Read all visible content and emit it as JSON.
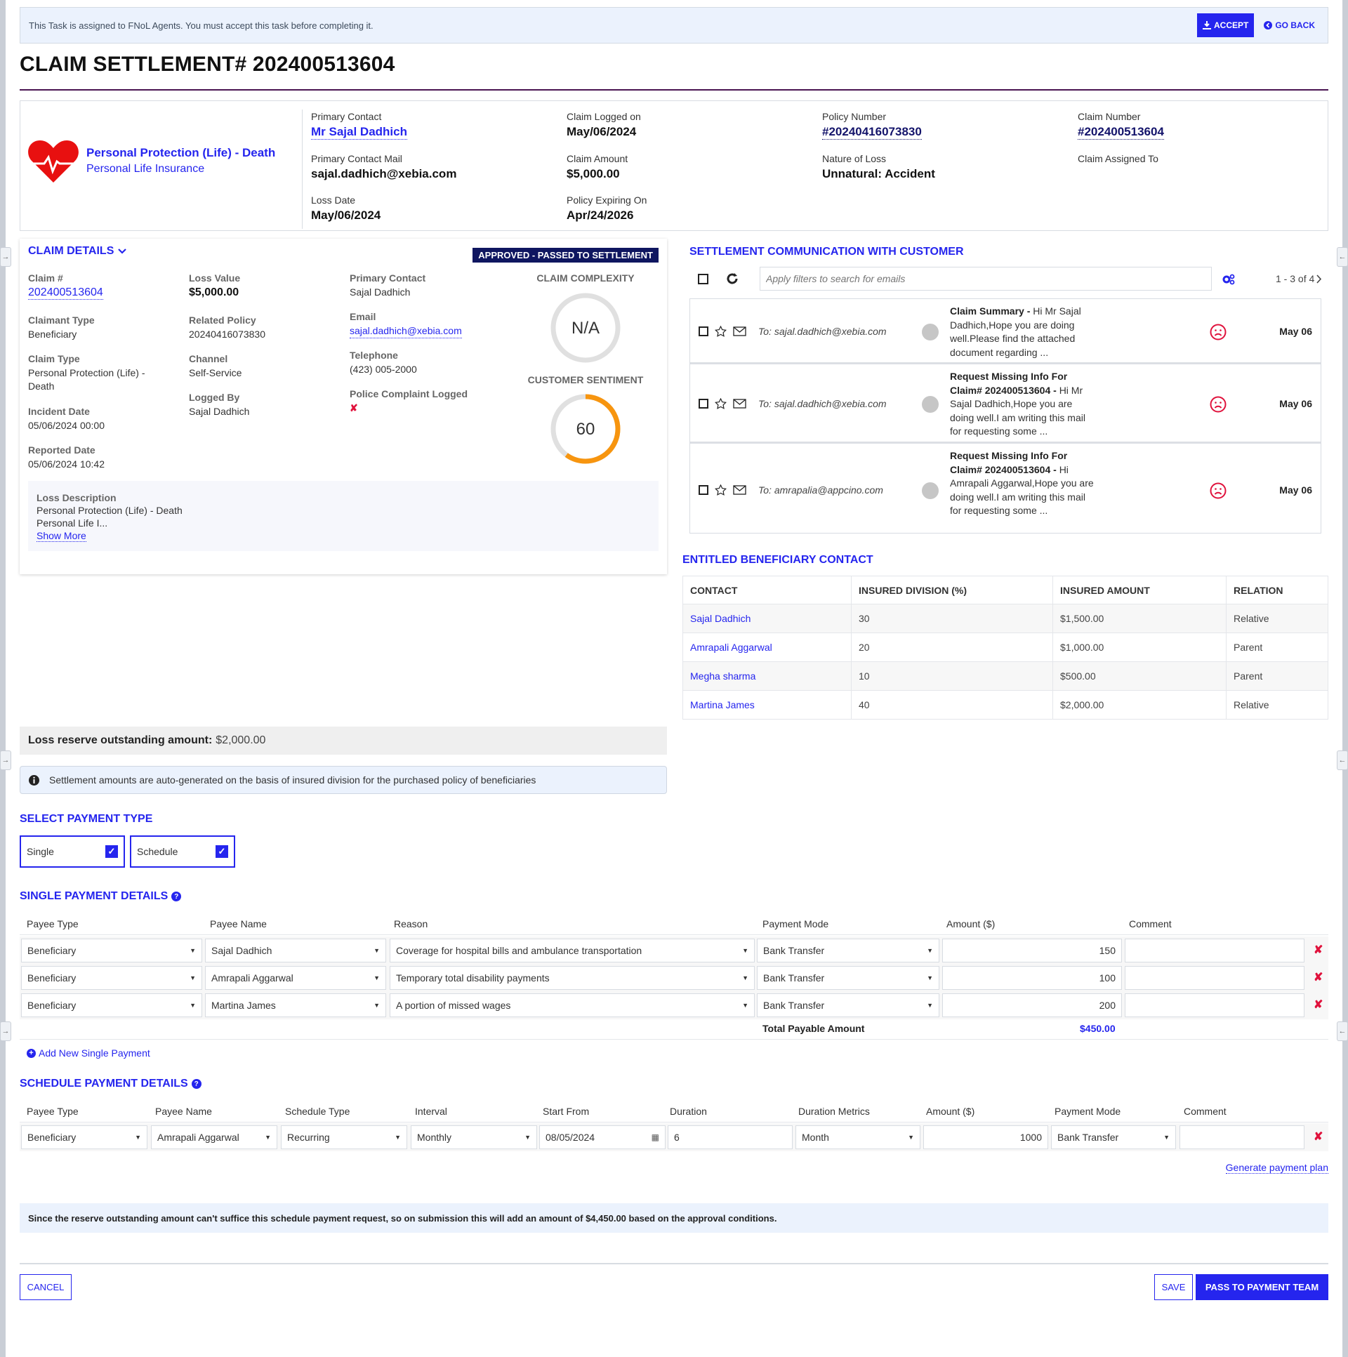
{
  "banner": {
    "message": "This Task is assigned to FNoL Agents. You must accept this task before completing it.",
    "accept_label": "ACCEPT",
    "go_back_label": "GO BACK"
  },
  "page_title": "CLAIM SETTLEMENT# 202400513604",
  "summary": {
    "product_name": "Personal Protection (Life) - Death",
    "product_sub": "Personal Life Insurance",
    "fields": {
      "primary_contact": {
        "label": "Primary Contact",
        "value": "Mr Sajal  Dadhich"
      },
      "primary_contact_mail": {
        "label": "Primary Contact Mail",
        "value": "sajal.dadhich@xebia.com"
      },
      "loss_date": {
        "label": "Loss Date",
        "value": "May/06/2024"
      },
      "claim_logged_on": {
        "label": "Claim Logged on",
        "value": "May/06/2024"
      },
      "claim_amount": {
        "label": "Claim Amount",
        "value": "$5,000.00"
      },
      "policy_expiring_on": {
        "label": "Policy Expiring On",
        "value": "Apr/24/2026"
      },
      "policy_number": {
        "label": "Policy Number",
        "value": "#20240416073830"
      },
      "nature_of_loss": {
        "label": "Nature of Loss",
        "value": "Unnatural: Accident"
      },
      "claim_number": {
        "label": "Claim Number",
        "value": "#202400513604"
      },
      "claim_assigned_to": {
        "label": "Claim Assigned To",
        "value": ""
      }
    }
  },
  "claim_details": {
    "title": "CLAIM DETAILS",
    "status": "APPROVED - PASSED TO SETTLEMENT",
    "claim_no": {
      "label": "Claim #",
      "value": "202400513604"
    },
    "claimant_type": {
      "label": "Claimant Type",
      "value": "Beneficiary"
    },
    "claim_type": {
      "label": "Claim Type",
      "value": "Personal Protection (Life) - Death"
    },
    "incident_date": {
      "label": "Incident Date",
      "value": "05/06/2024 00:00"
    },
    "reported_date": {
      "label": "Reported Date",
      "value": "05/06/2024 10:42"
    },
    "loss_value": {
      "label": "Loss Value",
      "value": "$5,000.00"
    },
    "related_policy": {
      "label": "Related Policy",
      "value": "20240416073830"
    },
    "channel": {
      "label": "Channel",
      "value": "Self-Service"
    },
    "logged_by": {
      "label": "Logged By",
      "value": "Sajal Dadhich"
    },
    "primary_contact": {
      "label": "Primary Contact",
      "value": "Sajal  Dadhich"
    },
    "email": {
      "label": "Email",
      "value": "sajal.dadhich@xebia.com"
    },
    "telephone": {
      "label": "Telephone",
      "value": "(423) 005-2000"
    },
    "police_complaint": {
      "label": "Police Complaint Logged",
      "value": "✘"
    },
    "complexity": {
      "label": "CLAIM COMPLEXITY",
      "value": "N/A"
    },
    "sentiment": {
      "label": "CUSTOMER SENTIMENT",
      "value": "60",
      "percent": 60
    },
    "loss_description": {
      "label": "Loss Description",
      "line1": "Personal Protection (Life) - Death",
      "line2": "Personal Life I...",
      "show_more": "Show More"
    }
  },
  "communication": {
    "title": "SETTLEMENT COMMUNICATION WITH CUSTOMER",
    "search_placeholder": "Apply filters to search for emails",
    "pagination": "1 - 3  of  4",
    "emails": [
      {
        "to": "To: sajal.dadhich@xebia.com",
        "subject": "Claim Summary - ",
        "preview": "Hi Mr Sajal Dadhich,Hope you are doing well.Please find the attached document regarding ...",
        "date": "May 06"
      },
      {
        "to": "To: sajal.dadhich@xebia.com",
        "subject": "Request Missing Info For Claim# 202400513604 - ",
        "preview": "Hi Mr Sajal  Dadhich,Hope you are doing well.I am writing this mail for requesting some  ...",
        "date": "May 06"
      },
      {
        "to": "To: amrapalia@appcino.com",
        "subject": "Request Missing Info For Claim# 202400513604 - ",
        "preview": "Hi Amrapali Aggarwal,Hope you are doing well.I am writing this mail for requesting some ...",
        "date": "May 06"
      }
    ]
  },
  "beneficiaries": {
    "title": "ENTITLED BENEFICIARY CONTACT",
    "headers": [
      "CONTACT",
      "INSURED DIVISION (%)",
      "INSURED AMOUNT",
      "RELATION"
    ],
    "rows": [
      [
        "Sajal  Dadhich",
        "30",
        "$1,500.00",
        "Relative"
      ],
      [
        "Amrapali Aggarwal",
        "20",
        "$1,000.00",
        "Parent"
      ],
      [
        "Megha sharma",
        "10",
        "$500.00",
        "Parent"
      ],
      [
        "Martina James",
        "40",
        "$2,000.00",
        "Relative"
      ]
    ]
  },
  "reserve": {
    "label": "Loss reserve outstanding amount:",
    "value": "$2,000.00"
  },
  "info_note": "Settlement amounts are auto-generated on the basis of insured division for the purchased policy of beneficiaries",
  "payment_type": {
    "title": "SELECT PAYMENT TYPE",
    "options": [
      {
        "label": "Single",
        "checked": true
      },
      {
        "label": "Schedule",
        "checked": true
      }
    ]
  },
  "single_payment": {
    "title": "SINGLE PAYMENT DETAILS",
    "headers": [
      "Payee Type",
      "Payee Name",
      "Reason",
      "Payment Mode",
      "Amount ($)",
      "Comment"
    ],
    "rows": [
      {
        "payee_type": "Beneficiary",
        "payee_name": "Sajal Dadhich",
        "reason": "Coverage for hospital bills and ambulance transportation",
        "mode": "Bank Transfer",
        "amount": "150",
        "comment": ""
      },
      {
        "payee_type": "Beneficiary",
        "payee_name": "Amrapali Aggarwal",
        "reason": "Temporary total disability payments",
        "mode": "Bank Transfer",
        "amount": "100",
        "comment": ""
      },
      {
        "payee_type": "Beneficiary",
        "payee_name": "Martina James",
        "reason": "A portion of missed wages",
        "mode": "Bank Transfer",
        "amount": "200",
        "comment": ""
      }
    ],
    "total_label": "Total Payable Amount",
    "total_value": "$450.00",
    "add_label": "Add New Single Payment"
  },
  "schedule_payment": {
    "title": "SCHEDULE PAYMENT DETAILS",
    "headers": [
      "Payee Type",
      "Payee Name",
      "Schedule Type",
      "Interval",
      "Start From",
      "Duration",
      "Duration Metrics",
      "Amount ($)",
      "Payment Mode",
      "Comment"
    ],
    "row": {
      "payee_type": "Beneficiary",
      "payee_name": "Amrapali Aggarwal",
      "schedule_type": "Recurring",
      "interval": "Monthly",
      "start_from": "08/05/2024",
      "duration": "6",
      "duration_metrics": "Month",
      "amount": "1000",
      "mode": "Bank Transfer",
      "comment": ""
    },
    "generate_label": "Generate payment plan"
  },
  "warning": "Since the reserve outstanding amount can't suffice this schedule payment request, so on submission this will add an amount of $4,450.00 based on the approval conditions.",
  "footer": {
    "cancel_label": "CANCEL",
    "save_label": "SAVE",
    "pass_label": "PASS TO PAYMENT TEAM"
  },
  "colors": {
    "accent": "#2525ee",
    "status_bg": "#0f1660",
    "danger": "#e0123c",
    "sentiment": "#f7950f",
    "heart": "#e81010"
  }
}
